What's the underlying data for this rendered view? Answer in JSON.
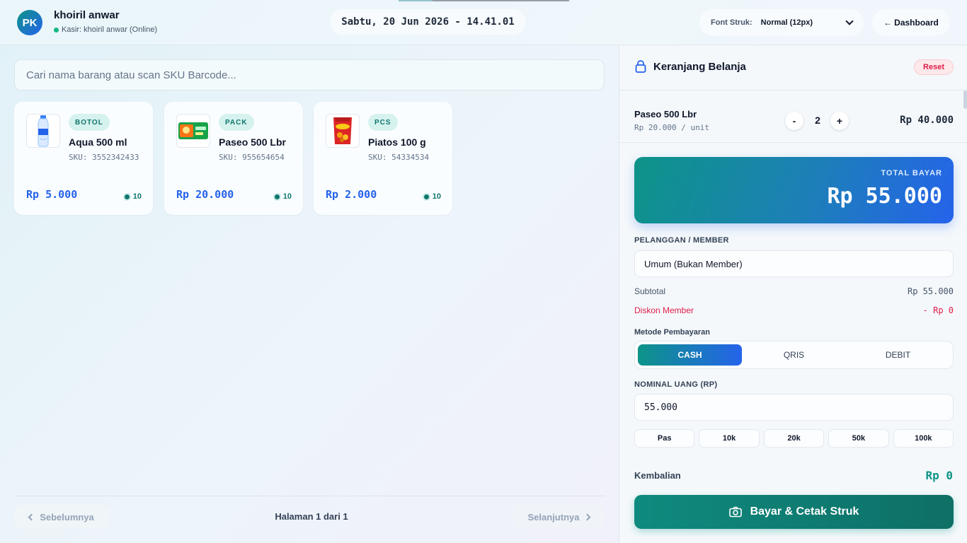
{
  "header": {
    "avatar_initials": "PK",
    "user_name": "khoiril anwar",
    "user_status": "Kasir: khoiril anwar (Online)",
    "datetime": "Sabtu, 20 Jun 2026 - 14.41.01",
    "font_label": "Font Struk:",
    "font_value": "Normal (12px)",
    "dashboard_label": "Dashboard"
  },
  "search": {
    "placeholder": "Cari nama barang atau scan SKU Barcode...",
    "value": ""
  },
  "products": [
    {
      "unit": "BOTOL",
      "name": "Aqua 500 ml",
      "sku": "SKU: 3552342433",
      "price": "Rp 5.000",
      "stock": "10",
      "icon": "water-bottle-icon"
    },
    {
      "unit": "PACK",
      "name": "Paseo 500 Lbr",
      "sku": "SKU: 955654654",
      "price": "Rp 20.000",
      "stock": "10",
      "icon": "tissue-pack-icon"
    },
    {
      "unit": "PCS",
      "name": "Piatos 100 g",
      "sku": "SKU: 54334534",
      "price": "Rp 2.000",
      "stock": "10",
      "icon": "snack-bag-icon"
    }
  ],
  "pagination": {
    "prev": "Sebelumnya",
    "info": "Halaman 1 dari 1",
    "next": "Selanjutnya"
  },
  "cart": {
    "title": "Keranjang Belanja",
    "reset": "Reset",
    "items": [
      {
        "name": "Paseo 500 Lbr",
        "unit_price": "Rp 20.000 / unit",
        "qty": "2",
        "minus": "-",
        "plus": "+",
        "total": "Rp 40.000"
      }
    ],
    "total_label": "TOTAL BAYAR",
    "total_value": "Rp 55.000",
    "customer_label": "PELANGGAN / MEMBER",
    "customer_value": "Umum (Bukan Member)",
    "subtotal_label": "Subtotal",
    "subtotal_value": "Rp 55.000",
    "discount_label": "Diskon Member",
    "discount_value": "- Rp 0",
    "method_label": "Metode Pembayaran",
    "methods": [
      "CASH",
      "QRIS",
      "DEBIT"
    ],
    "active_method": "CASH",
    "nominal_label": "NOMINAL UANG (RP)",
    "nominal_value": "55.000",
    "quick_amounts": [
      "Pas",
      "10k",
      "20k",
      "50k",
      "100k"
    ],
    "change_label": "Kembalian",
    "change_value": "Rp 0",
    "pay_button": "Bayar & Cetak Struk"
  },
  "colors": {
    "accent_teal": "#0d9488",
    "accent_blue": "#2563eb",
    "danger": "#e11d48"
  }
}
